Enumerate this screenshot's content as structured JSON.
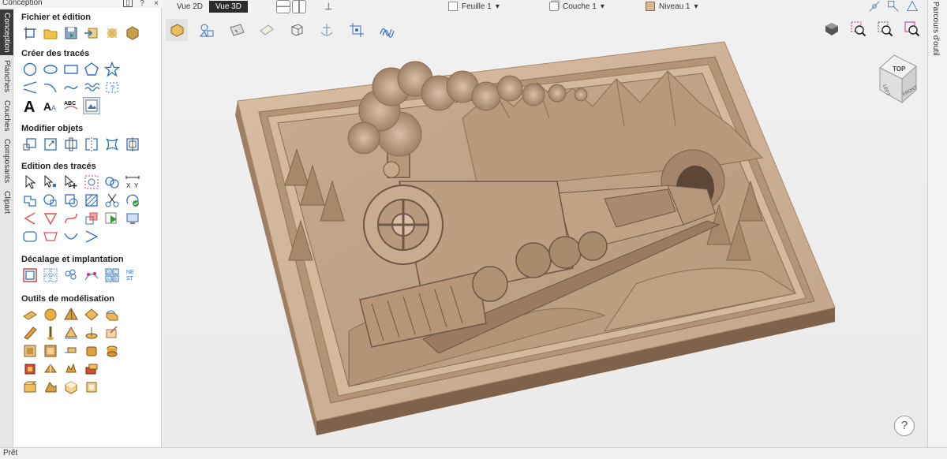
{
  "panel": {
    "title": "Conception",
    "ctrl_pin": "▯",
    "ctrl_help": "?",
    "ctrl_close": "×"
  },
  "vertical_tabs": [
    "Conception",
    "Planches",
    "Couches",
    "Composants",
    "Clipart"
  ],
  "sections": {
    "file": "Fichier et édition",
    "create": "Créer des tracés",
    "modify": "Modifier objets",
    "edit": "Edition des tracés",
    "offset": "Décalage et implantation",
    "modeling": "Outils de modélisation"
  },
  "viewport": {
    "view2d": "Vue 2D",
    "view3d": "Vue 3D",
    "sheet": "Feuille 1",
    "layer": "Couche 1",
    "level": "Niveau 1",
    "dropdown_arrow": "▾",
    "help": "?",
    "pin": "⊥"
  },
  "viewcube": {
    "top": "TOP",
    "left": "LEFT",
    "front": "FRONT"
  },
  "right_tab": "Parcours d'outil",
  "status": "Prêt",
  "colors": {
    "wood_light": "#c9ab8f",
    "wood_mid": "#a98a6f",
    "wood_dark": "#6e5746",
    "accent_blue": "#2f6fc0",
    "accent_orange": "#e89a2a"
  }
}
